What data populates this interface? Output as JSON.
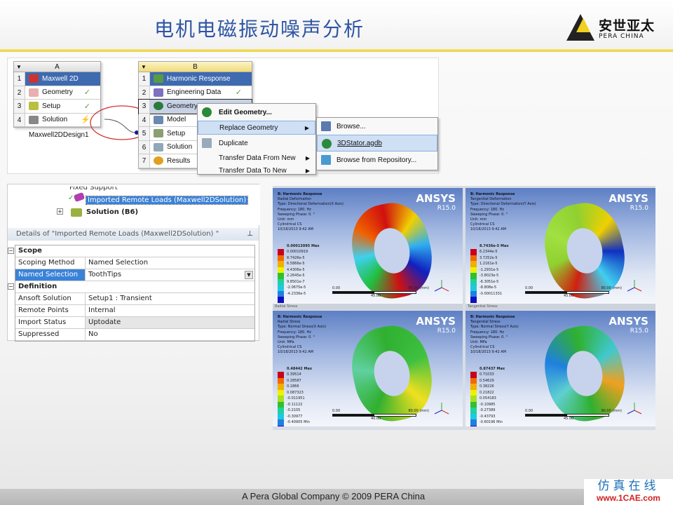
{
  "slide": {
    "title": "电机电磁振动噪声分析",
    "logo_cn": "安世亚太",
    "logo_en": "PERA CHINA",
    "footer": "A Pera Global Company © 2009 PERA China",
    "watermark_cn": "仿真在线",
    "watermark_url": "www.1CAE.com"
  },
  "workbench": {
    "systemA": {
      "col": "A",
      "name": "Maxwell2DDesign1",
      "rows": [
        {
          "n": "1",
          "label": "Maxwell 2D"
        },
        {
          "n": "2",
          "label": "Geometry",
          "check": "✓"
        },
        {
          "n": "3",
          "label": "Setup",
          "check": "✓"
        },
        {
          "n": "4",
          "label": "Solution",
          "check": "⚡"
        }
      ]
    },
    "systemB": {
      "col": "B",
      "rows": [
        {
          "n": "1",
          "label": "Harmonic Response"
        },
        {
          "n": "2",
          "label": "Engineering Data",
          "check": "✓"
        },
        {
          "n": "3",
          "label": "Geometry"
        },
        {
          "n": "4",
          "label": "Model"
        },
        {
          "n": "5",
          "label": "Setup"
        },
        {
          "n": "6",
          "label": "Solution"
        },
        {
          "n": "7",
          "label": "Results"
        }
      ]
    },
    "context_menu": [
      "Edit Geometry...",
      "Replace Geometry",
      "Duplicate",
      "Transfer Data From New",
      "Transfer Data To New"
    ],
    "submenu": [
      "Browse...",
      "3DStator.agdb",
      "Browse from Repository..."
    ]
  },
  "details": {
    "tree": {
      "item_partial": "Fixed Support",
      "selected": "Imported Remote Loads (Maxwell2DSolution)",
      "solution": "Solution (B6)"
    },
    "title": "Details of \"Imported Remote Loads (Maxwell2DSolution) \"",
    "scope": "Scope",
    "definition": "Definition",
    "scope_rows": [
      {
        "k": "Scoping Method",
        "v": "Named Selection"
      },
      {
        "k": "Named Selection",
        "v": "ToothTips"
      }
    ],
    "def_rows": [
      {
        "k": "Ansoft Solution",
        "v": "Setup1 : Transient"
      },
      {
        "k": "Remote Points",
        "v": "Internal"
      },
      {
        "k": "Import Status",
        "v": "Uptodate"
      },
      {
        "k": "Suppressed",
        "v": "No"
      }
    ]
  },
  "results": {
    "brand": "ANSYS",
    "version": "R15.0",
    "captions": [
      "Radial Stress",
      "Tangential Stress"
    ],
    "legend_colors": [
      "#c8001a",
      "#f06a00",
      "#f0b000",
      "#f0f000",
      "#a8e020",
      "#30c030",
      "#20d0a0",
      "#20c8e0",
      "#2080e0",
      "#1010c0"
    ],
    "panels": [
      {
        "lines": [
          "B: Harmonic Response",
          "Radial Deformation",
          "Type: Directional Deformation(X Axis)",
          "Frequency: 180. Hz",
          "Sweeping Phase: 0. °",
          "Unit: mm",
          "Cylindrical CS",
          "10/18/2013 9:42 AM"
        ],
        "legend": [
          "0.00013095 Max",
          "0.00010919",
          "8.7426e-5",
          "6.5866e-5",
          "4.4306e-5",
          "2.2645e-5",
          "9.8501e-7",
          "-2.0675e-5",
          "-4.2336e-5"
        ],
        "scale": [
          "0.00",
          "90.00 (mm)",
          "45.00"
        ]
      },
      {
        "lines": [
          "B: Harmonic Response",
          "Tangential Deformation",
          "Type: Directional Deformation(Y Axis)",
          "Frequency: 180. Hz",
          "Sweeping Phase: 0. °",
          "Unit: mm",
          "Cylindrical CS",
          "10/18/2013 9:42 AM"
        ],
        "legend": [
          "8.7436e-5 Max",
          "6.2344e-5",
          "3.7252e-5",
          "1.2161e-5",
          "-1.2931e-5",
          "-3.8023e-5",
          "-6.3051e-5",
          "-8.808e-5",
          "-0.00011331"
        ],
        "scale": [
          "0.00",
          "90.00 (mm)",
          "45.00"
        ]
      },
      {
        "lines": [
          "B: Harmonic Response",
          "Radial Stress",
          "Type: Normal Stress(X Axis)",
          "Frequency: 180. Hz",
          "Sweeping Phase: 0. °",
          "Unit: MPa",
          "Cylindrical CS",
          "10/18/2013 9:42 AM"
        ],
        "legend": [
          "0.48442 Max",
          "0.39514",
          "0.28587",
          "0.1866",
          "0.087323",
          "-0.011951",
          "-0.11122",
          "-0.2105",
          "-0.30977",
          "-0.40905 Min"
        ],
        "scale": [
          "0.00",
          "80.00 (mm)",
          "40.00"
        ]
      },
      {
        "lines": [
          "B: Harmonic Response",
          "Tangential Stress",
          "Type: Normal Stress(Y Axis)",
          "Frequency: 180. Hz",
          "Sweeping Phase: 0. °",
          "Unit: MPa",
          "Cylindrical CS",
          "10/18/2013 9:42 AM"
        ],
        "legend": [
          "0.87437 Max",
          "0.71033",
          "0.54629",
          "0.38226",
          "0.21822",
          "0.054183",
          "-0.10985",
          "-0.27389",
          "-0.43793",
          "-0.60196 Min"
        ],
        "scale": [
          "0.00",
          "90.00 (mm)",
          "45.00"
        ]
      }
    ]
  }
}
